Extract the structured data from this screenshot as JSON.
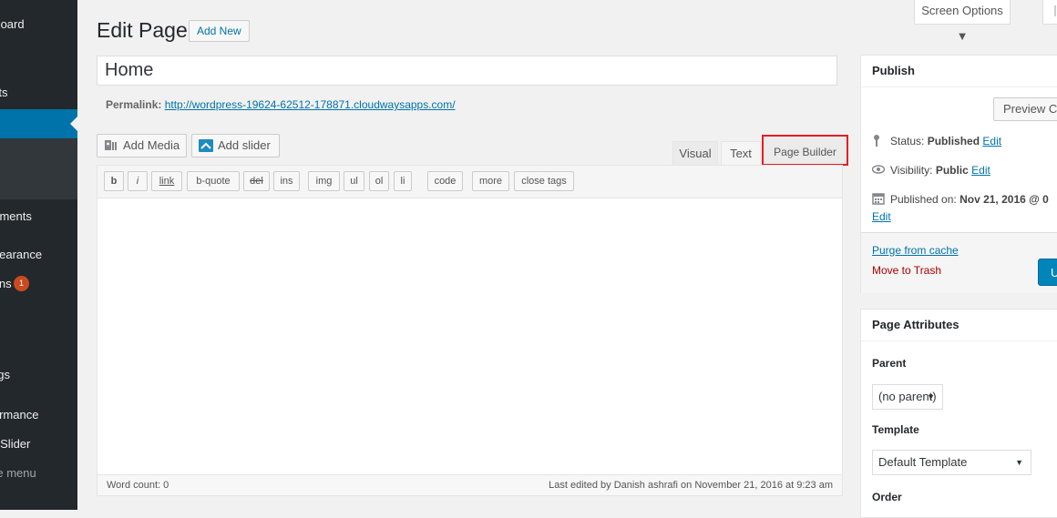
{
  "sidebar": {
    "items": [
      {
        "label": "Dashboard"
      },
      {
        "label": "Posts"
      },
      {
        "label": "Comments"
      },
      {
        "label": "Appearance"
      },
      {
        "label": "Plugins",
        "badge": "1"
      },
      {
        "label": "Settings"
      },
      {
        "label": "Performance"
      },
      {
        "label": "Layer Slider"
      },
      {
        "label": "Collapse menu"
      }
    ]
  },
  "header": {
    "title": "Edit Page",
    "add_new": "Add New",
    "screen_options": "Screen Options ▼"
  },
  "post": {
    "title": "Home",
    "permalink_label": "Permalink:",
    "permalink_url": "http://wordpress-19624-62512-178871.cloudwaysapps.com/"
  },
  "media": {
    "add_media": "Add Media",
    "add_slider": "Add slider"
  },
  "editor_tabs": {
    "visual": "Visual",
    "text": "Text",
    "page_builder": "Page Builder"
  },
  "quicktags": [
    "b",
    "i",
    "link",
    "b-quote",
    "del",
    "ins",
    "img",
    "ul",
    "ol",
    "li",
    "code",
    "more",
    "close tags"
  ],
  "status": {
    "word_count": "Word count: 0",
    "last_edited": "Last edited by Danish ashrafi on November 21, 2016 at 9:23 am"
  },
  "publish": {
    "title": "Publish",
    "preview": "Preview Ch",
    "status_label": "Status:",
    "status_value": "Published",
    "visibility_label": "Visibility:",
    "visibility_value": "Public",
    "published_on_label": "Published on:",
    "published_on_value": "Nov 21, 2016 @ 0",
    "edit": "Edit",
    "purge": "Purge from cache",
    "trash": "Move to Trash",
    "update": "U"
  },
  "attributes": {
    "title": "Page Attributes",
    "parent_label": "Parent",
    "parent_value": "(no parent)",
    "template_label": "Template",
    "template_value": "Default Template",
    "order_label": "Order"
  },
  "colors": {
    "sidebar_bg": "#23282d",
    "accent": "#0073aa",
    "highlight_border": "#e31e24",
    "danger": "#aa0000"
  }
}
